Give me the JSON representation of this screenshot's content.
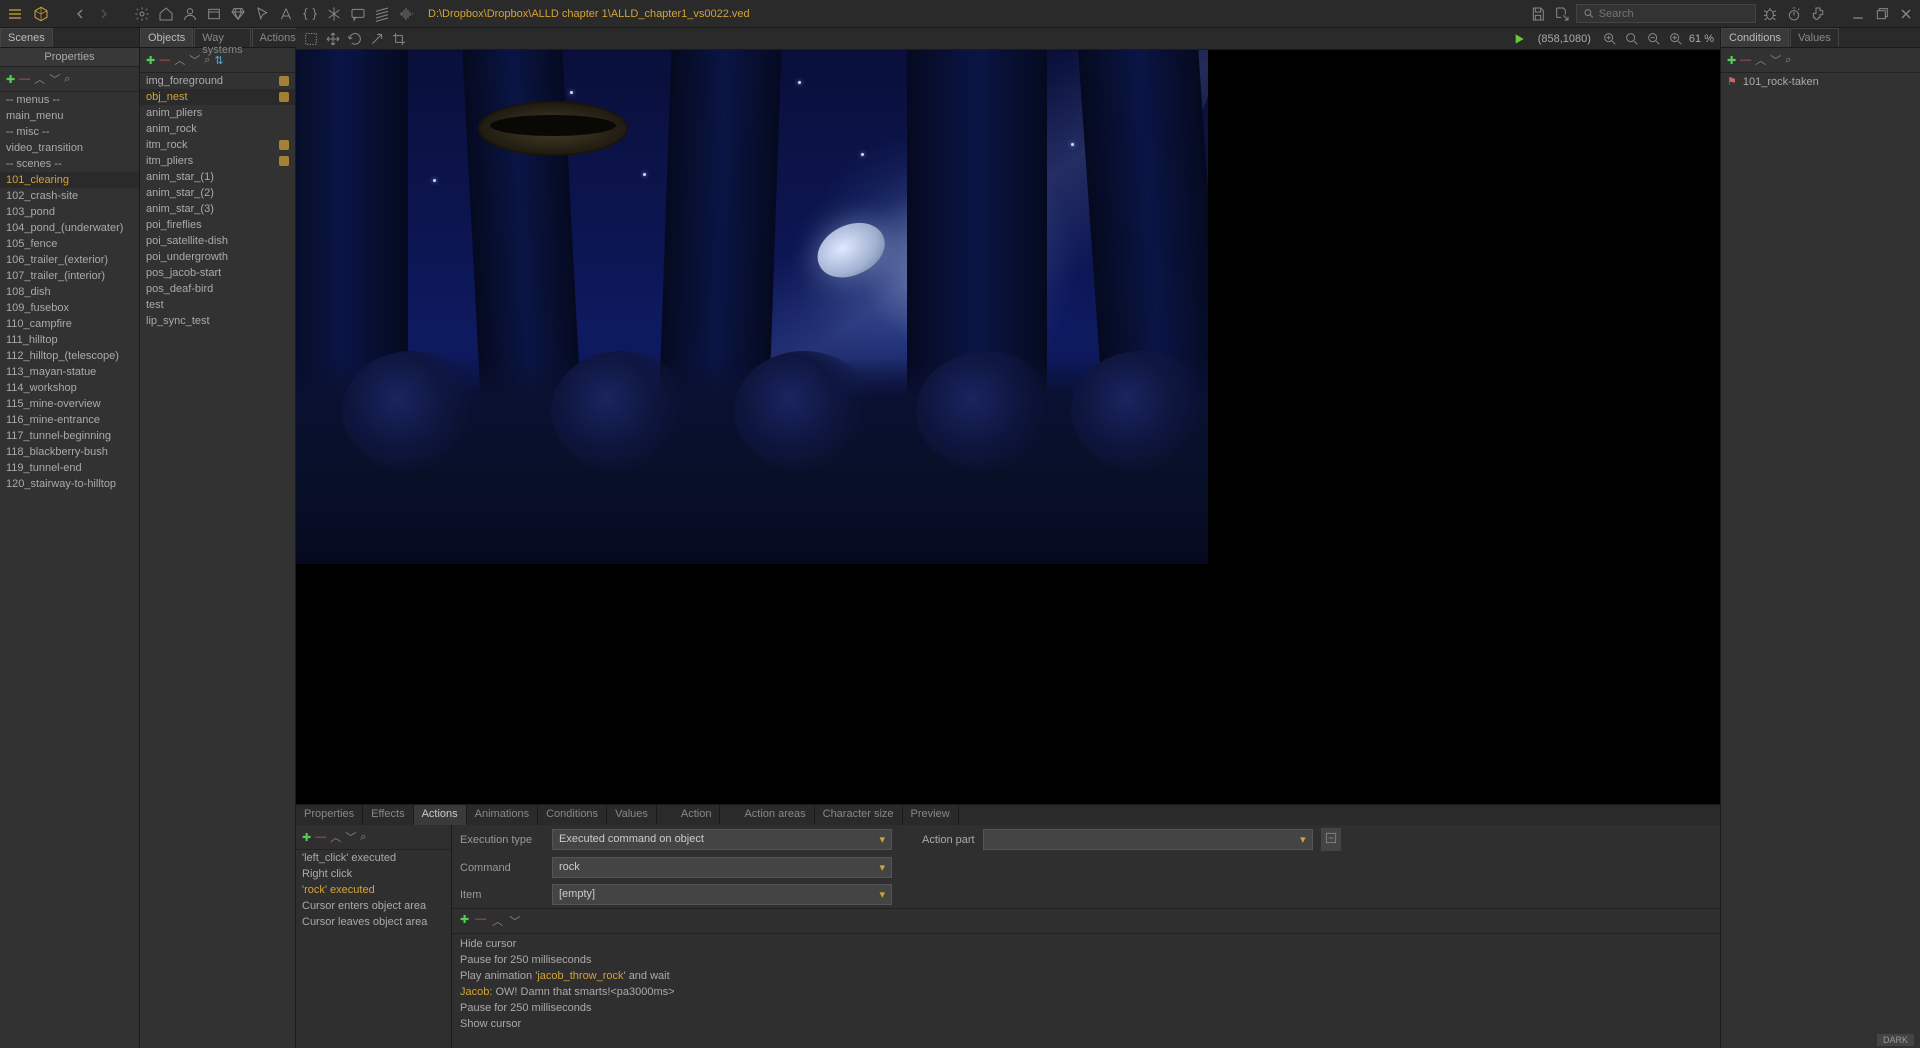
{
  "toolbar": {
    "file_path": "D:\\Dropbox\\Dropbox\\ALLD chapter 1\\ALLD_chapter1_vs0022.ved",
    "search_placeholder": "Search"
  },
  "viewport": {
    "coords": "(858,1080)",
    "zoom": "61 %"
  },
  "scenes": {
    "tab": "Scenes",
    "header": "Properties",
    "items": [
      "-- menus --",
      "main_menu",
      "-- misc --",
      "video_transition",
      "-- scenes --",
      "101_clearing",
      "102_crash-site",
      "103_pond",
      "104_pond_(underwater)",
      "105_fence",
      "106_trailer_(exterior)",
      "107_trailer_(interior)",
      "108_dish",
      "109_fusebox",
      "110_campfire",
      "111_hilltop",
      "112_hilltop_(telescope)",
      "113_mayan-statue",
      "114_workshop",
      "115_mine-overview",
      "116_mine-entrance",
      "117_tunnel-beginning",
      "118_blackberry-bush",
      "119_tunnel-end",
      "120_stairway-to-hilltop"
    ],
    "selected": 5
  },
  "objects": {
    "tabs": [
      "Objects",
      "Way systems",
      "Actions"
    ],
    "active": 0,
    "items": [
      {
        "label": "img_foreground",
        "img": true
      },
      {
        "label": "obj_nest",
        "img": true
      },
      {
        "label": "anim_pliers"
      },
      {
        "label": "anim_rock"
      },
      {
        "label": "itm_rock",
        "img": true
      },
      {
        "label": "itm_pliers",
        "img": true
      },
      {
        "label": "anim_star_(1)"
      },
      {
        "label": "anim_star_(2)"
      },
      {
        "label": "anim_star_(3)"
      },
      {
        "label": "poi_fireflies"
      },
      {
        "label": "poi_satellite-dish"
      },
      {
        "label": "poi_undergrowth"
      },
      {
        "label": "pos_jacob-start"
      },
      {
        "label": "pos_deaf-bird"
      },
      {
        "label": "test"
      },
      {
        "label": "lip_sync_test"
      }
    ],
    "selected": 1
  },
  "bottom": {
    "tabs_left": [
      "Properties",
      "Effects",
      "Actions",
      "Animations",
      "Conditions",
      "Values"
    ],
    "tabs_left_active": 2,
    "tabs_mid": [
      "Action"
    ],
    "tabs_right": [
      "Action areas",
      "Character size",
      "Preview"
    ],
    "actions": [
      "'left_click' executed",
      "Right click",
      "'rock' executed",
      "Cursor enters object area",
      "Cursor leaves object area"
    ],
    "actions_selected": 2,
    "props": {
      "exec_type_label": "Execution type",
      "exec_type_value": "Executed command on object",
      "command_label": "Command",
      "command_value": "rock",
      "item_label": "Item",
      "item_value": "[empty]",
      "action_part_label": "Action part",
      "action_part_value": ""
    },
    "script": [
      {
        "text": "Hide cursor"
      },
      {
        "text": "Pause for 250 milliseconds"
      },
      {
        "pre": "Play animation '",
        "orange": "jacob_throw_rock",
        "post": "' and wait"
      },
      {
        "orange": "Jacob:",
        "post": " OW! Damn that smarts!<pa3000ms>"
      },
      {
        "text": "Pause for 250 milliseconds"
      },
      {
        "text": "Show cursor"
      }
    ]
  },
  "right": {
    "tabs": [
      "Conditions",
      "Values"
    ],
    "active": 0,
    "items": [
      "101_rock-taken"
    ]
  }
}
